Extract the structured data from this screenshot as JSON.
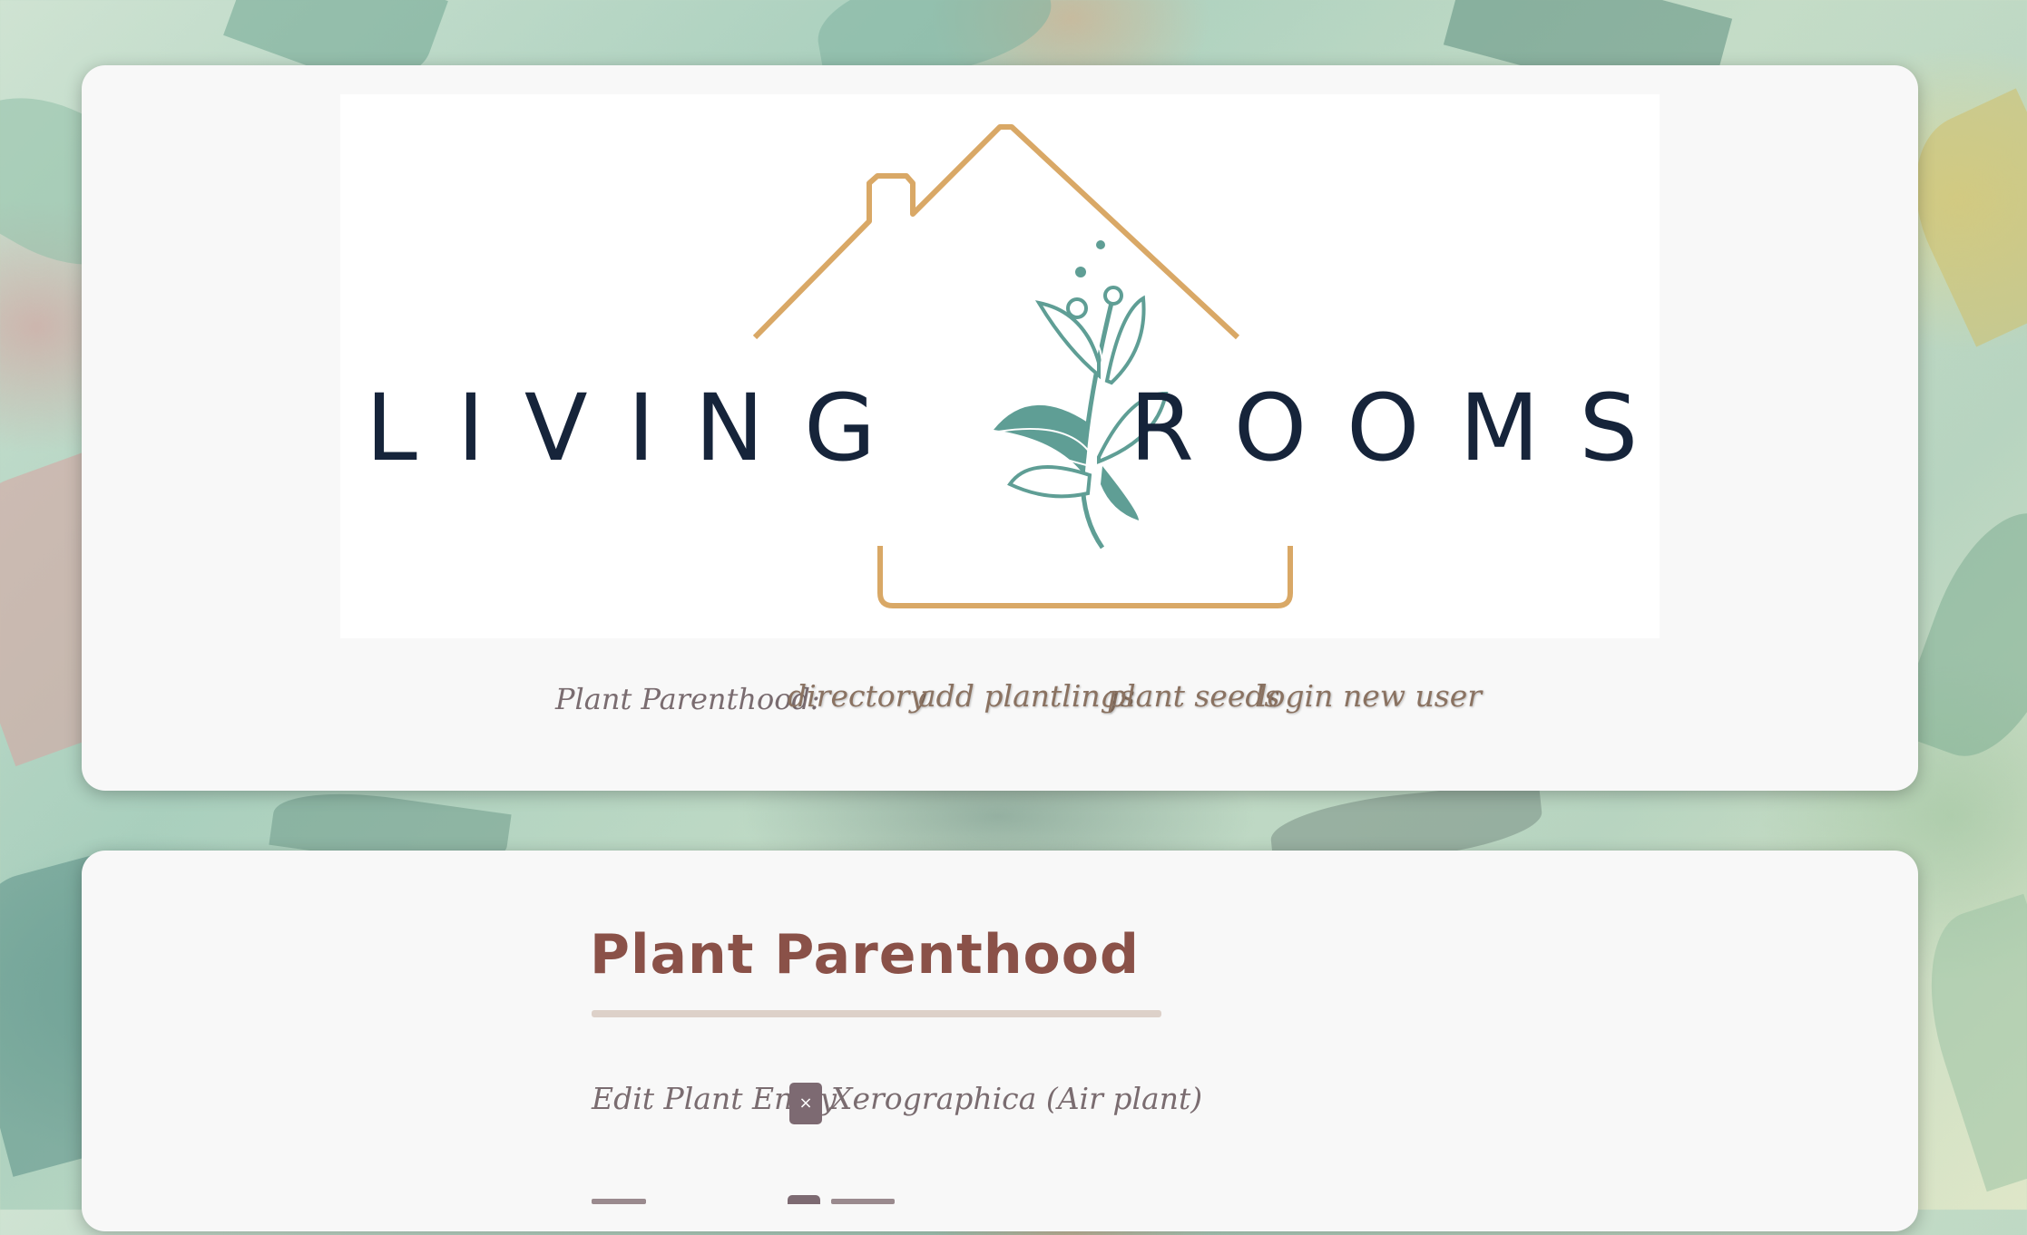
{
  "brand": {
    "logo_word_left": "LIVING",
    "logo_word_right": "ROOMS",
    "logo_line_color": "#d9a866",
    "logo_plant_color": "#5f9e95",
    "logo_text_color": "#16243a"
  },
  "nav": {
    "label": "Plant Parenthood:",
    "links": [
      "directory",
      "add plantlings",
      "plant seeds",
      "login",
      "new user"
    ]
  },
  "main": {
    "title": "Plant Parenthood",
    "entry_label": "Edit Plant Entry",
    "close_label": "×",
    "plant_name": "Xerographica (Air plant)"
  },
  "icons": {
    "close": "close-icon",
    "logo": "house-plant-logo"
  },
  "colors": {
    "panel_bg": "#f8f8f8",
    "title_color": "#8a5148",
    "link_color": "#8a7261",
    "text_color": "#7a6c70",
    "button_bg": "#7d6a72",
    "rule_color": "#ddd1c9"
  }
}
